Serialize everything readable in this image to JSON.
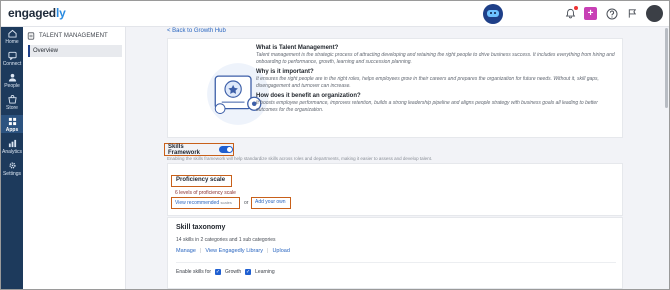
{
  "app": {
    "logo_text": "engagedly",
    "logo_main": "engaged",
    "logo_accent": "ly"
  },
  "left_nav": [
    {
      "label": "Home",
      "icon": "home-icon"
    },
    {
      "label": "Connect",
      "icon": "connect-icon"
    },
    {
      "label": "People",
      "icon": "people-icon"
    },
    {
      "label": "Store",
      "icon": "store-icon"
    },
    {
      "label": "Apps",
      "icon": "apps-icon",
      "active": true
    },
    {
      "label": "Analytics",
      "icon": "analytics-icon"
    },
    {
      "label": "Settings",
      "icon": "gear-icon"
    }
  ],
  "subnav": {
    "title": "TALENT MANAGEMENT",
    "items": [
      "Overview"
    ]
  },
  "back_link": "< Back to Growth Hub",
  "intro": {
    "q1": "What is Talent Management?",
    "a1": "Talent management is the strategic process of attracting developing and retaining the right people to drive business success. It includes everything from hiring and onboarding to performance, growth, learning and succession planning.",
    "q2": "Why is it important?",
    "a2": "It ensures the right people are in the right roles, helps employees grow in their careers and prepares the organization for future needs. Without it, skill gaps, disengagement and turnover can increase.",
    "q3": "How does it benefit an organization?",
    "a3": "It boosts employee performance, improves retention, builds a strong leadership pipeline and aligns people strategy with business goals all leading to better outcomes for the organization."
  },
  "skills_framework": {
    "label": "Skills Framework",
    "enabled": true,
    "description": "Enabling the skills framework will help standardize skills across roles and departments, making it easier to assess and develop talent."
  },
  "proficiency": {
    "title": "Proficiency scale",
    "subtitle": "6 levels of proficiency scale",
    "view_link": "View recommended",
    "scales_word": "scales",
    "or_text": "or",
    "add_link": "Add your own"
  },
  "taxonomy": {
    "title": "Skill taxonomy",
    "subtitle": "14 skills in 2 categories and 1 sub categories",
    "links": [
      "Manage",
      "View Engagedly Library",
      "Upload"
    ],
    "enable_label": "Enable skills for",
    "options": [
      {
        "label": "Growth",
        "checked": true
      },
      {
        "label": "Learning",
        "checked": true
      }
    ]
  },
  "colors": {
    "nav_bg": "#1d3a5c",
    "accent_blue": "#1f5fd1",
    "highlight_border": "#c8601a",
    "link": "#2a66c0"
  }
}
